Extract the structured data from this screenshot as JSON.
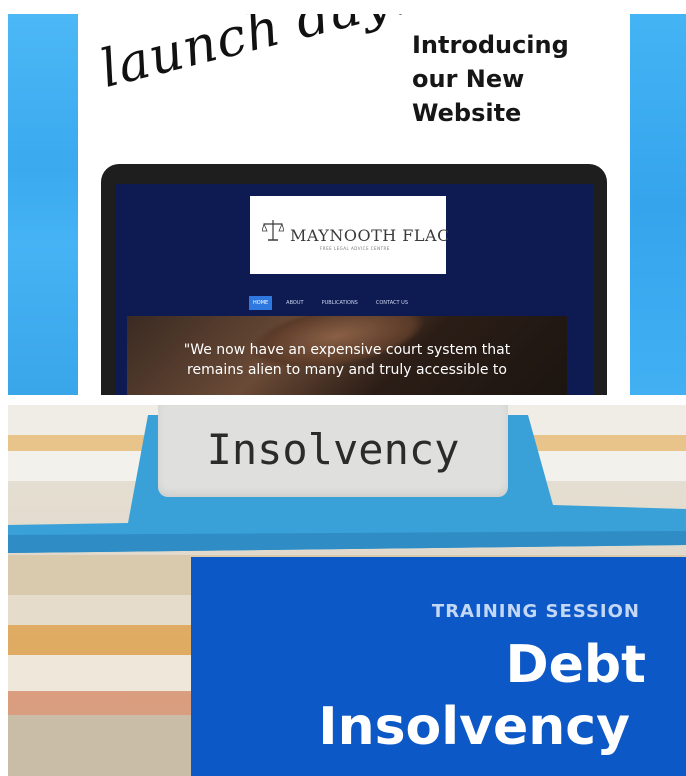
{
  "top_post": {
    "script_text": "launch day!",
    "headline": [
      "Introducing",
      "our New",
      "Website"
    ],
    "website": {
      "logo_title": "MAYNOOTH FLAC",
      "logo_subtitle": "FREE LEGAL ADVICE CENTRE",
      "nav": [
        "HOME",
        "ABOUT",
        "PUBLICATIONS",
        "CONTACT US"
      ],
      "active_nav": "HOME",
      "quote_lines": [
        "\"We now have an expensive court system that",
        "remains alien to many and truly accessible to"
      ]
    },
    "colors": {
      "background_blue": "#3fb0f5",
      "site_navy": "#0d1b52",
      "nav_active": "#2f78e0"
    }
  },
  "bottom_post": {
    "folder_label": "Insolvency",
    "eyebrow": "TRAINING SESSION",
    "title": [
      "Debt",
      "Insolvency"
    ],
    "colors": {
      "panel_blue": "#0d58c7",
      "folder_tab": "#3aa0d8"
    }
  }
}
